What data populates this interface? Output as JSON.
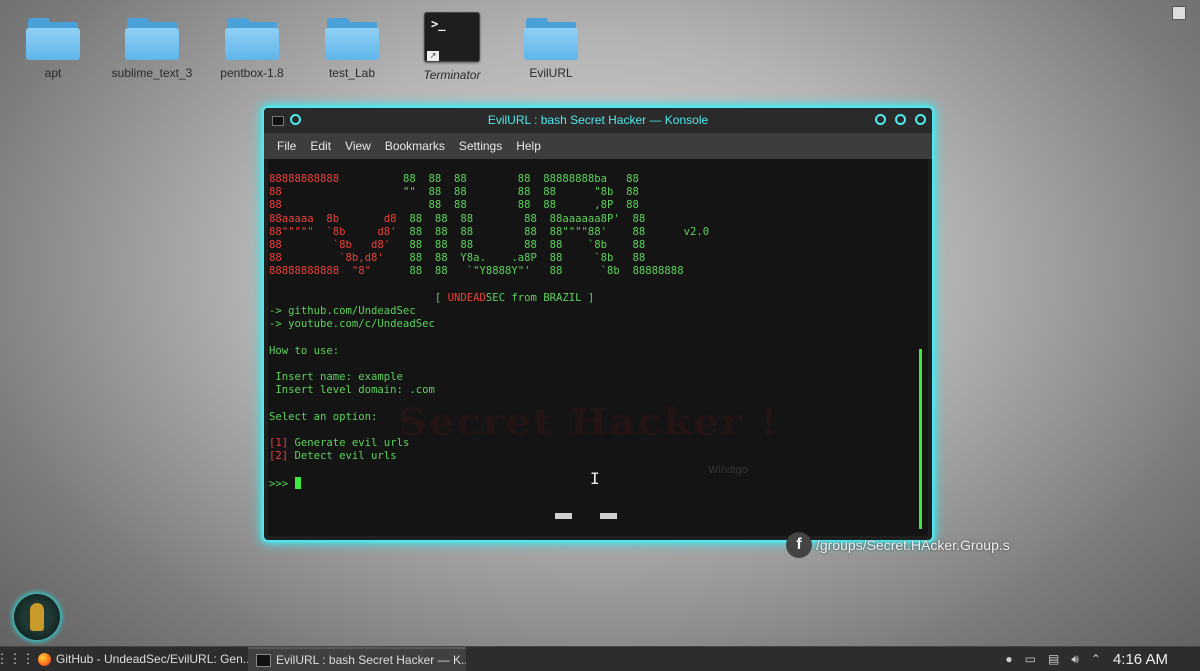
{
  "desktop": {
    "icons": [
      {
        "label": "apt",
        "type": "folder"
      },
      {
        "label": "sublime_text_3",
        "type": "folder"
      },
      {
        "label": "pentbox-1.8",
        "type": "folder"
      },
      {
        "label": "test_Lab",
        "type": "folder"
      },
      {
        "label": "Terminator",
        "type": "terminal"
      },
      {
        "label": "EvilURL",
        "type": "folder"
      }
    ]
  },
  "window": {
    "title": "EvilURL : bash Secret Hacker — Konsole",
    "menu": [
      "File",
      "Edit",
      "View",
      "Bookmarks",
      "Settings",
      "Help"
    ]
  },
  "terminal": {
    "banner_lines": [
      [
        "88888888888          ",
        "88  88  88        88  88888888ba   88"
      ],
      [
        "88                   \"\"  88  88        88  88      \"8b  88",
        ""
      ],
      [
        "88                       88  88        88  88      ,8P  88",
        ""
      ],
      [
        "88aaaaa  8b       d8  88  88  88        88  88aaaaaa8P'  88",
        ""
      ],
      [
        "88\"\"\"\"\"  `8b     d8'  88  88  88        88  88\"\"\"\"88'    88      v2.0",
        ""
      ],
      [
        "88        `8b   d8'   88  88  88        88  88    `8b    88",
        ""
      ],
      [
        "88         `8b,d8'    88  88  Y8a.    .a8P  88     `8b   88",
        ""
      ],
      [
        "88888888888  \"8\"      88  88   `\"Y8888Y\"'   88      `8b  88888888",
        ""
      ]
    ],
    "tagline_open": "[ ",
    "tagline_red": "UNDEAD",
    "tagline_rest": "SEC from BRAZIL ]",
    "links": [
      "-> github.com/UndeadSec",
      "-> youtube.com/c/UndeadSec"
    ],
    "howto_title": "How to use:",
    "howto_lines": [
      " Insert name: example",
      " Insert level domain: .com"
    ],
    "select_prompt": "Select an option:",
    "options": [
      {
        "num": "[1]",
        "text": " Generate evil urls"
      },
      {
        "num": "[2]",
        "text": " Detect evil urls"
      }
    ],
    "prompt": ">>> ",
    "watermark": "Secret Hacker !",
    "watermark_sub": "Windigo"
  },
  "overlay": {
    "fb_icon": "f",
    "fb_text": "/groups/Secret.HAcker.Group.s"
  },
  "taskbar": {
    "launcher_icon": "apps-grid-icon",
    "tasks": [
      {
        "label": "GitHub - UndeadSec/EvilURL: Gen...",
        "icon": "firefox-icon"
      },
      {
        "label": "EvilURL : bash Secret Hacker — K...",
        "icon": "konsole-icon"
      }
    ],
    "clock": "4:16 AM"
  }
}
